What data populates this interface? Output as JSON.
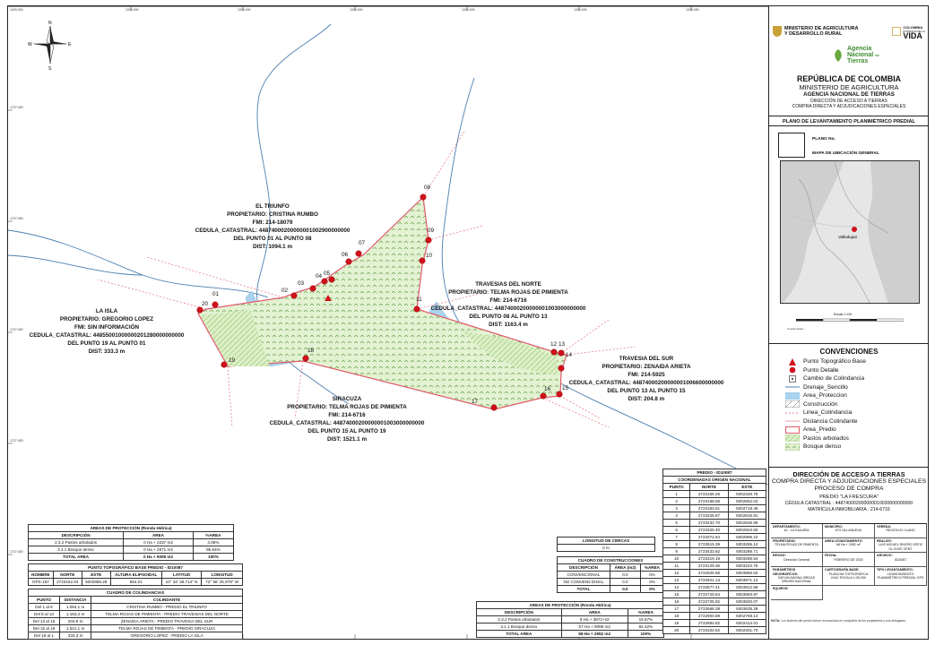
{
  "north_arrow": {
    "n": "N",
    "s": "S",
    "e": "E",
    "w": "W"
  },
  "grid_ticks_top": [
    "1000.000",
    "1000.000",
    "1000.000",
    "1000.000",
    "1000.000",
    "1000.000",
    "1000.000"
  ],
  "grid_ticks_left": [
    "1727.000",
    "1727.000",
    "1727.000",
    "1727.000",
    "1727.000"
  ],
  "parcel_labels": [
    {
      "lines": [
        "EL TRIUNFO",
        "PROPIETARIO: CRISTINA RUMBO",
        "FMI: 214-18079",
        "CEDULA_CATASTRAL: 44874000200000001002900000000",
        "DEL PUNTO 01 AL PUNTO 08",
        "DIST: 1094.1 m"
      ]
    },
    {
      "lines": [
        "LA ISLA",
        "PROPIETARIO: GREGORIO LOPEZ",
        "FMI: SIN INFORMACIÓN",
        "CEDULA_CATASTRAL: 44855001000000201280000000000",
        "DEL PUNTO 19 AL PUNTO 01",
        "DIST: 333.3 m"
      ]
    },
    {
      "lines": [
        "TRAVESIAS DEL NORTE",
        "PROPIETARIO: TELMA ROJAS DE PIMIENTA",
        "FMI: 214-6716",
        "CEDULA_CATASTRAL: 44874000200000001003000000000",
        "DEL PUNTO 08 AL PUNTO 13",
        "DIST: 1163.4 m"
      ]
    },
    {
      "lines": [
        "TRAVESIA DEL SUR",
        "PROPIETARIO: ZENAIDA ARIETA",
        "FMI: 214-5925",
        "CEDULA_CATASTRAL: 44874000200000001006600000000",
        "DEL PUNTO 13 AL PUNTO 15",
        "DIST: 204.8 m"
      ]
    },
    {
      "lines": [
        "SIRACUZA",
        "PROPIETARIO: TELMA ROJAS DE PIMIENTA",
        "FMI: 214-6716",
        "CEDULA_CATASTRAL: 44874000200000001003000000000",
        "DEL PUNTO 15 AL PUNTO 19",
        "DIST: 1521.1 m"
      ]
    }
  ],
  "point_numbers": [
    "01",
    "02",
    "03",
    "04",
    "05",
    "06",
    "07",
    "08",
    "09",
    "10",
    "11",
    "12",
    "13",
    "14",
    "15",
    "16",
    "17",
    "18",
    "19",
    "20"
  ],
  "header": {
    "ministry_logo": "MINISTERIO DE AGRICULTURA Y DESARROLLO RURAL",
    "colombia_logo_top": "COLOMBIA",
    "colombia_logo_sub": "POTENCIA DE LA",
    "colombia_logo_big": "VIDA",
    "ant_logo": [
      "Agencia",
      "Nacional",
      "Tierras"
    ],
    "ant_logo_de": "de",
    "republic": "REPÚBLICA DE COLOMBIA",
    "ministry": "MINISTERIO DE AGRICULTURA",
    "agency": "AGENCIA NACIONAL DE TIERRAS",
    "direction": "DIRECCIÓN DE ACCESO A TIERRAS",
    "subdirection": "COMPRA DIRECTA Y ADJUDICACIONES ESPECIALES",
    "plan_title": "PLANO DE LEVANTAMIENTO PLANIMÉTRICO PREDIAL",
    "plano_no": "PLANO No.",
    "mapa_ubicacion": "MAPA DE UBICACIÓN GENERAL",
    "city": "Valledupar",
    "escala": "Escala",
    "escala_val": "1:100",
    "nota_coord": "Coordenadas..."
  },
  "legend": {
    "title": "CONVENCIONES",
    "items": [
      "Punto Topográfico Base",
      "Punto Detalle",
      "Cambio de Colindancia",
      "Drenaje_Sencillo",
      "Area_Proteccion",
      "Construcción",
      "Linea_Colindancia",
      "Distancia Colindante",
      "Area_Predio",
      "Pastos arbolados",
      "Bosque denso"
    ]
  },
  "title_block": {
    "direction": "DIRECCIÓN DE ACCESO A TIERRAS",
    "subdirection": "COMPRA DIRECTA Y ADJUDICACIONES ESPECIALES",
    "process": "PROCESO DE COMPRA",
    "predio": "PREDIO \"LA FRESCURA\"",
    "cedula": "CÉDULA CATASTRAL : 448740002000000010030000000000",
    "matricula": "MATRÍCULA INMOBILIARIA : 214-6716",
    "grid": [
      {
        "label": "DEPARTAMENTO:",
        "value": "44 - LA GUAJIRA"
      },
      {
        "label": "MUNICIPIO:",
        "value": "874 VILLANUEVA"
      },
      {
        "label": "VEREDA:",
        "value": "REGIÓN EL LLANO"
      },
      {
        "label": "PROPIETARIO:",
        "value": "TELMA ROJAS DE PIMIENTA"
      },
      {
        "label": "AREA LEVANTAMIENTO:",
        "value": "68 Ha + 2952 m²"
      },
      {
        "label": "REALIZÓ:",
        "value": "LUIS MIGUEL RIVERO ORTIZ 01-21997 CPNT"
      },
      {
        "label": "REVISÓ:",
        "value": "Dirección General"
      },
      {
        "label": "FECHA:",
        "value": "FEBRERO DE 2020"
      },
      {
        "label": "ARCHIVO:",
        "value": "ID10087"
      },
      {
        "label": "PARÁMETROS GEOGRÁFICOS:",
        "value": "DATUM MAGNA SIRGAS ORIGEN NACIONAL"
      },
      {
        "label": "CARTOGRAFÍA BASE:",
        "value": "PLANCHA TOPOGRÁFICA IGAC ESCALA 1:25.000"
      },
      {
        "label": "TIPO LEVANTAMIENTO:",
        "value": "LEVANTAMIENTO PLANIMÉTRICO PREDIAL GPS"
      },
      {
        "label": "EQUIPOS:",
        "value": ""
      }
    ],
    "nota_label": "NOTA:",
    "nota": "Los linderos del predio fueron reconocidos en compañía de los propietarios y sus delegados."
  },
  "coords_table": {
    "caption": "PREDIO - ID10087",
    "subcaption": "COORDENADAS ORIGEN NACIONAL",
    "headers": [
      "PUNTO",
      "NORTE",
      "ESTE"
    ],
    "rows": [
      [
        "1",
        "2723156.26",
        "5002346.78"
      ],
      [
        "2",
        "2723168.55",
        "5002652.04"
      ],
      [
        "3",
        "2723183.51",
        "5002719.48"
      ],
      [
        "4",
        "2723226.87",
        "5002816.81"
      ],
      [
        "5",
        "2723232.70",
        "5002836.86"
      ],
      [
        "6",
        "2723325.40",
        "5002923.50"
      ],
      [
        "7",
        "2723372.64",
        "5002996.22"
      ],
      [
        "8",
        "2723615.39",
        "5003265.14"
      ],
      [
        "9",
        "2723433.82",
        "5003286.71"
      ],
      [
        "10",
        "2723319.19",
        "5003286.54"
      ],
      [
        "11",
        "2723129.36",
        "5003242.75"
      ],
      [
        "12",
        "2722925.68",
        "5003865.63"
      ],
      [
        "13",
        "2722921.13",
        "5003871.12"
      ],
      [
        "14",
        "2722877.41",
        "5003912.58"
      ],
      [
        "15",
        "2722729.64",
        "5003893.97"
      ],
      [
        "16",
        "2722725.82",
        "5003820.07"
      ],
      [
        "17",
        "2722668.38",
        "5003635.28"
      ],
      [
        "18",
        "2722900.89",
        "5002769.14"
      ],
      [
        "19",
        "2722884.82",
        "5002414.01"
      ],
      [
        "20",
        "2723104.62",
        "5002301.70"
      ]
    ]
  },
  "areas_table_small": {
    "caption": "AREAS DE PROTECCIÓN (Ronda Hídrica)",
    "headers": [
      "DESCRIPCIÓN",
      "AREA",
      "%AREA"
    ],
    "rows": [
      [
        "2.3.2 Pastos arbolados",
        "0 Ha + 2237 m2",
        "4.05%"
      ],
      [
        "3.1.1 Bosque denso",
        "0 Ha + 2871 m2",
        "95.94%"
      ]
    ],
    "total": [
      "TOTAL AREA",
      "0 Ha + 5008 m2",
      "100%"
    ]
  },
  "base_point_table": {
    "caption": "PUNTO TOPOGRÁFICO BASE PREDIO - ID10087",
    "headers": [
      "NOMBRE",
      "NORTE",
      "ESTE",
      "ALTURA ELIPSOIDAL",
      "LATITUD",
      "LONGITUD"
    ],
    "rows": [
      [
        "GPS-197",
        "2723152.94",
        "5002856.28",
        "584.01",
        "10° 32' 38.714\" N",
        "72° 58' 25.979\" W"
      ]
    ]
  },
  "colindancias_table": {
    "caption": "CUADRO DE COLINDANCIAS",
    "headers": [
      "PUNTO",
      "DISTANCIA",
      "COLINDANTE"
    ],
    "rows": [
      [
        "Del 1 al 8",
        "1.094,1 m",
        "CRISTINA RUMBO - PREDIO EL TRIUNFO"
      ],
      [
        "Del 8 al 13",
        "1.163,4 m",
        "TELMA ROJAS DE PIMIENTA - PREDIO TRAVESIAS DEL NORTE"
      ],
      [
        "Del 13 al 15",
        "204,8 m",
        "ZENAIDA ARIETA - PREDIO TRAVESIA DEL SUR"
      ],
      [
        "Del 15 al 19",
        "1.521,1 m",
        "TELMA ROJAS DE PIMIENTA - PREDIO SIRACUZA"
      ],
      [
        "Del 19 al 1",
        "333,3 m",
        "GREGORIO LOPEZ - PREDIO LA ISLA"
      ]
    ]
  },
  "fence_table": {
    "caption": "LONGITUD DE CERCAS",
    "value": "0 m"
  },
  "construction_table": {
    "caption": "CUADRO DE CONSTRUCCIONES",
    "headers": [
      "DESCRIPCIÓN",
      "ÁREA (m2)",
      "%AREA"
    ],
    "rows": [
      [
        "CONVENCIONAL",
        "0.0",
        "0%"
      ],
      [
        "NO CONVENCIONAL",
        "0.0",
        "0%"
      ]
    ],
    "total": [
      "TOTAL",
      "0.0",
      "0%"
    ]
  },
  "areas_table_big": {
    "caption": "AREAS DE PROTECCIÓN (Ronda Hídrica)",
    "headers": [
      "DESCRIPCIÓN",
      "AREA",
      "%AREA"
    ],
    "rows": [
      [
        "2.3.2 Pastos arbolados",
        "9 Ha + 3873 m2",
        "15.57%"
      ],
      [
        "3.1.1 Bosque denso",
        "57 Ha + 9089 m2",
        "84.42%"
      ]
    ],
    "total": [
      "TOTAL AREA",
      "68 Ha + 2952 m2",
      "100%"
    ]
  },
  "colors": {
    "boundary": "#e05a6a",
    "water": "#a9d3ef",
    "pasture": "#cfe8b0",
    "forest": "#5c9a3a",
    "point": "#d1111b"
  }
}
